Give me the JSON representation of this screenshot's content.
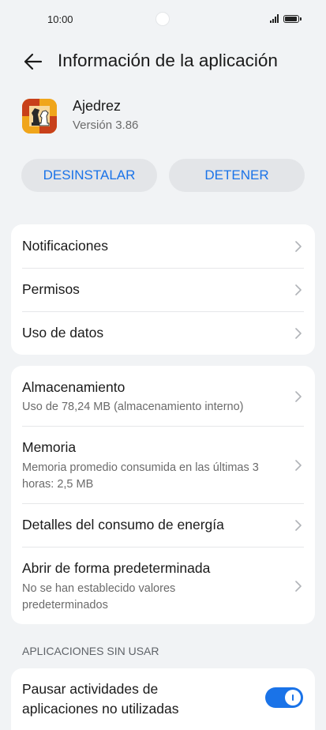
{
  "status_bar": {
    "time": "10:00"
  },
  "header": {
    "title": "Información de la aplicación"
  },
  "app": {
    "name": "Ajedrez",
    "version": "Versión 3.86"
  },
  "actions": {
    "uninstall": "DESINSTALAR",
    "stop": "DETENER"
  },
  "group1": [
    {
      "title": "Notificaciones"
    },
    {
      "title": "Permisos"
    },
    {
      "title": "Uso de datos"
    }
  ],
  "group2": [
    {
      "title": "Almacenamiento",
      "subtitle": "Uso de 78,24 MB (almacenamiento interno)"
    },
    {
      "title": "Memoria",
      "subtitle": "Memoria promedio consumida en las últimas 3 horas: 2,5 MB"
    },
    {
      "title": "Detalles del consumo de energía"
    },
    {
      "title": "Abrir de forma predeterminada",
      "subtitle": "No se han establecido valores predeterminados"
    }
  ],
  "unused_section": {
    "label": "APLICACIONES SIN USAR",
    "pause_title": "Pausar actividades de aplicaciones no utilizadas",
    "toggle_on": true
  },
  "colors": {
    "accent": "#1a73e8",
    "background": "#f1f3f5",
    "button_bg": "#e3e5e8"
  }
}
